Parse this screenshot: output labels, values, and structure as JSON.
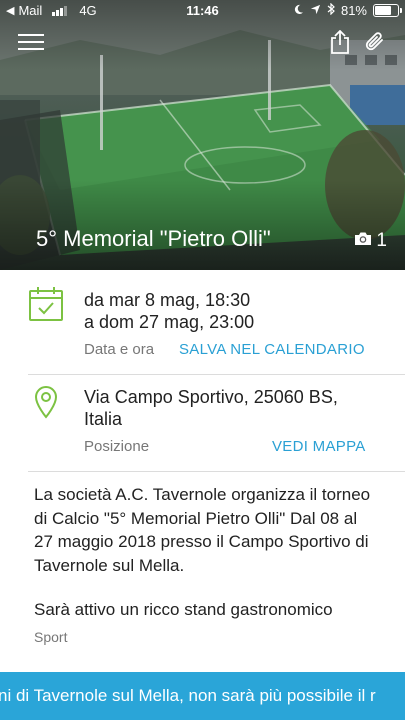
{
  "status_bar": {
    "carrier": "Mail",
    "network": "4G",
    "time": "11:46",
    "battery": "81%",
    "battery_level": 0.81
  },
  "hero": {
    "title": "5° Memorial \"Pietro Olli\"",
    "photo_count": "1"
  },
  "date_section": {
    "start": "da mar 8 mag, 18:30",
    "end": "a dom 27 mag, 23:00",
    "label": "Data e ora",
    "action": "SALVA NEL CALENDARIO"
  },
  "location_section": {
    "line1": "Via Campo Sportivo, 25060 BS,",
    "line2": "Italia",
    "label": "Posizione",
    "action": "VEDI MAPPA"
  },
  "description": {
    "paragraph1": "La società A.C. Tavernole organizza il torneo di Calcio \"5° Memorial Pietro Olli\" Dal 08 al 27 maggio 2018 presso il Campo Sportivo di Tavernole sul Mella.",
    "paragraph2": "Sarà attivo un ricco stand gastronomico",
    "category": "Sport"
  },
  "banner": {
    "text": "ni di Tavernole sul Mella, non sarà più possibile il r"
  },
  "colors": {
    "accent": "#2aa0d4",
    "icon_green": "#7cc242",
    "banner": "#2aa5d8"
  }
}
